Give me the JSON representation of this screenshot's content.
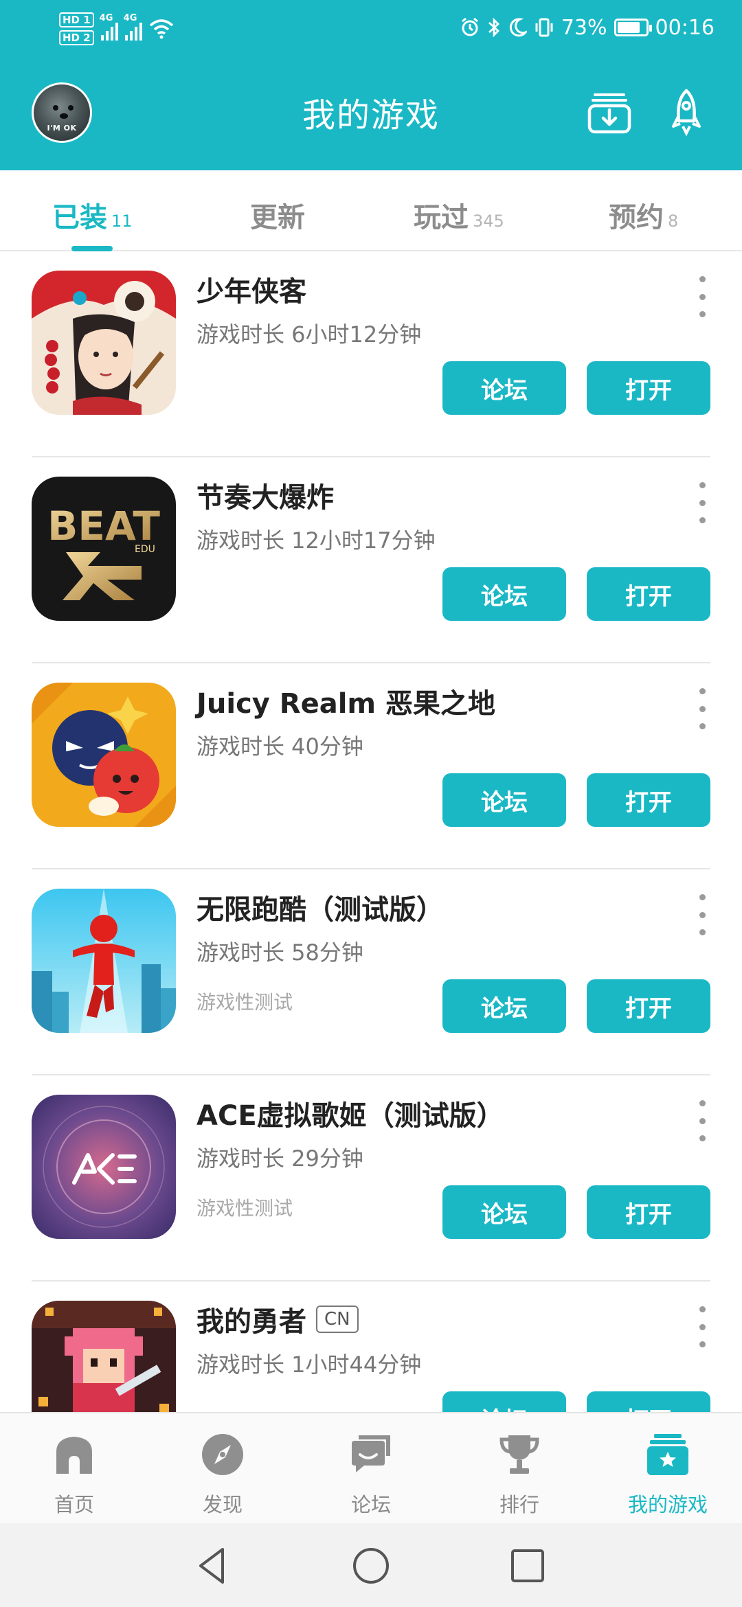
{
  "status_bar": {
    "hd1": "HD 1",
    "hd2": "HD 2",
    "net1": "4G",
    "net2": "4G",
    "battery_percent": "73%",
    "battery_level": 0.73,
    "time": "00:16"
  },
  "header": {
    "avatar_text": "I'M OK",
    "title": "我的游戏",
    "icons": [
      "download-icon",
      "rocket-icon"
    ]
  },
  "tabs": [
    {
      "label": "已装",
      "count": "11",
      "active": true
    },
    {
      "label": "更新",
      "count": "",
      "active": false
    },
    {
      "label": "玩过",
      "count": "345",
      "active": false
    },
    {
      "label": "预约",
      "count": "8",
      "active": false
    }
  ],
  "games": [
    {
      "name": "少年侠客",
      "badge": "",
      "playtime": "游戏时长 6小时12分钟",
      "test": "",
      "forum": "论坛",
      "open": "打开"
    },
    {
      "name": "节奏大爆炸",
      "badge": "",
      "playtime": "游戏时长 12小时17分钟",
      "test": "",
      "forum": "论坛",
      "open": "打开"
    },
    {
      "name": "Juicy Realm 恶果之地",
      "badge": "",
      "playtime": "游戏时长 40分钟",
      "test": "",
      "forum": "论坛",
      "open": "打开"
    },
    {
      "name": "无限跑酷（测试版）",
      "badge": "",
      "playtime": "游戏时长 58分钟",
      "test": "游戏性测试",
      "forum": "论坛",
      "open": "打开"
    },
    {
      "name": "ACE虚拟歌姬（测试版）",
      "badge": "",
      "playtime": "游戏时长 29分钟",
      "test": "游戏性测试",
      "forum": "论坛",
      "open": "打开"
    },
    {
      "name": "我的勇者",
      "badge": "CN",
      "playtime": "游戏时长 1小时44分钟",
      "test": "",
      "forum": "论坛",
      "open": "打开"
    }
  ],
  "bottom_nav": [
    {
      "label": "首页",
      "icon": "home-icon",
      "active": false
    },
    {
      "label": "发现",
      "icon": "compass-icon",
      "active": false
    },
    {
      "label": "论坛",
      "icon": "forum-icon",
      "active": false
    },
    {
      "label": "排行",
      "icon": "trophy-icon",
      "active": false
    },
    {
      "label": "我的游戏",
      "icon": "my-games-icon",
      "active": true
    }
  ],
  "colors": {
    "accent": "#1ab8c5",
    "tab_inactive": "#8c8c8c",
    "divider": "#e6e6e6"
  }
}
